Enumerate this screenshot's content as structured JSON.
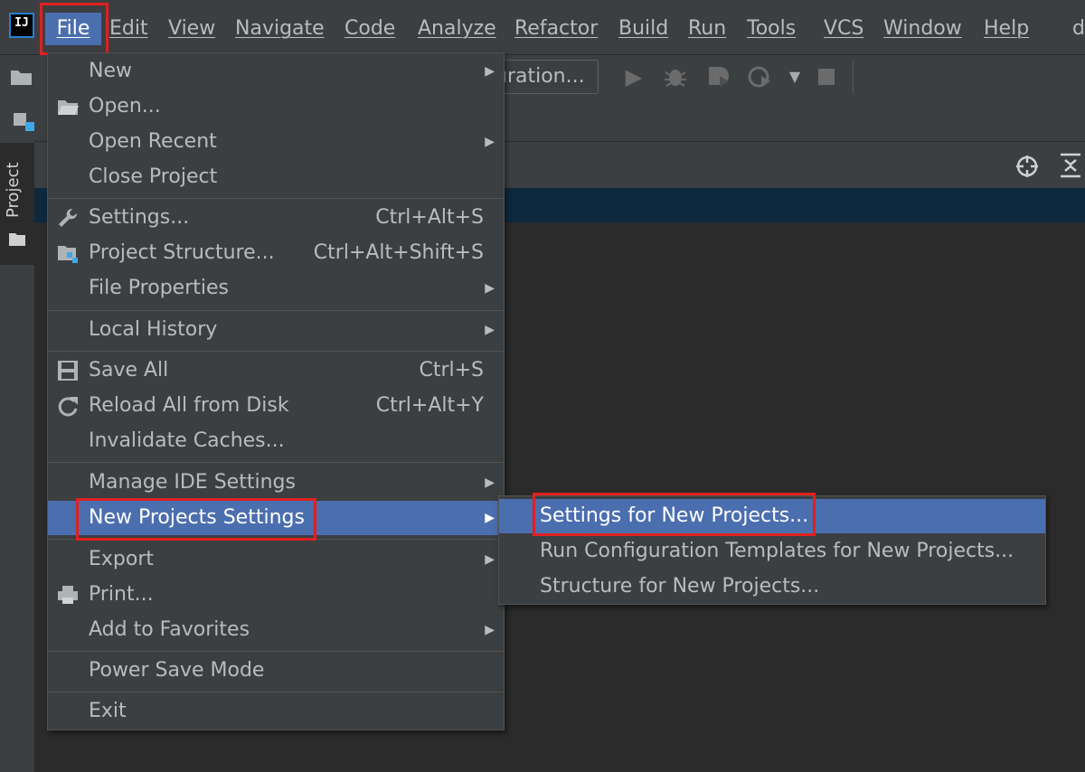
{
  "menubar": {
    "logo": "IJ",
    "items": [
      "File",
      "Edit",
      "View",
      "Navigate",
      "Code",
      "Analyze",
      "Refactor",
      "Build",
      "Run",
      "Tools",
      "VCS",
      "Window",
      "Help"
    ],
    "overflow_text": "d"
  },
  "toolbar": {
    "run_config_label": "uration..."
  },
  "sidebar": {
    "project_tab_label": "Project"
  },
  "file_menu": {
    "items": [
      {
        "label": "New",
        "submenu": true
      },
      {
        "label": "Open...",
        "icon": "folder-open-icon"
      },
      {
        "label": "Open Recent",
        "submenu": true
      },
      {
        "label": "Close Project"
      },
      {
        "label": "Settings...",
        "shortcut": "Ctrl+Alt+S",
        "icon": "wrench-icon"
      },
      {
        "label": "Project Structure...",
        "shortcut": "Ctrl+Alt+Shift+S",
        "icon": "project-structure-icon"
      },
      {
        "label": "File Properties",
        "submenu": true
      },
      {
        "label": "Local History",
        "submenu": true
      },
      {
        "label": "Save All",
        "shortcut": "Ctrl+S",
        "icon": "save-icon"
      },
      {
        "label": "Reload All from Disk",
        "shortcut": "Ctrl+Alt+Y",
        "icon": "reload-icon"
      },
      {
        "label": "Invalidate Caches..."
      },
      {
        "label": "Manage IDE Settings",
        "submenu": true
      },
      {
        "label": "New Projects Settings",
        "submenu": true,
        "highlighted": true
      },
      {
        "label": "Export",
        "submenu": true
      },
      {
        "label": "Print...",
        "icon": "printer-icon"
      },
      {
        "label": "Add to Favorites",
        "submenu": true
      },
      {
        "label": "Power Save Mode"
      },
      {
        "label": "Exit"
      }
    ]
  },
  "new_projects_submenu": {
    "items": [
      {
        "label": "Settings for New Projects...",
        "highlighted": true
      },
      {
        "label": "Run Configuration Templates for New Projects..."
      },
      {
        "label": "Structure for New Projects..."
      }
    ]
  },
  "colors": {
    "background": "#3c3f41",
    "editor": "#2b2b2b",
    "highlight": "#4b6eaf",
    "annotation_red": "#e02020"
  }
}
